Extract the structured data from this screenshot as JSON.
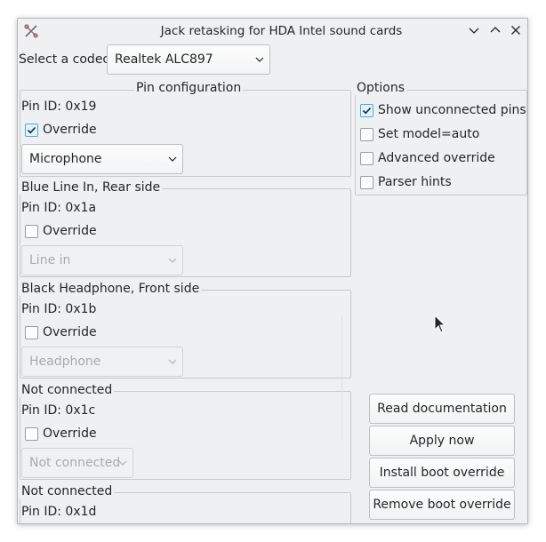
{
  "window": {
    "title": "Jack retasking for HDA Intel sound cards",
    "icons": [
      "app-icon",
      "minimize-icon",
      "maximize-icon",
      "close-icon"
    ]
  },
  "codec": {
    "label": "Select a codec:",
    "selected": "Realtek ALC897"
  },
  "pins": [
    {
      "title": "Pin configuration",
      "pin_id": "Pin ID: 0x19",
      "override_label": "Override",
      "override": true,
      "selection": "Microphone",
      "enabled": true
    },
    {
      "title": "Blue Line In, Rear side",
      "pin_id": "Pin ID: 0x1a",
      "override_label": "Override",
      "override": false,
      "selection": "Line in",
      "enabled": false
    },
    {
      "title": "Black Headphone, Front side",
      "pin_id": "Pin ID: 0x1b",
      "override_label": "Override",
      "override": false,
      "selection": "Headphone",
      "enabled": false
    },
    {
      "title": "Not connected",
      "pin_id": "Pin ID: 0x1c",
      "override_label": "Override",
      "override": false,
      "selection": "Not connected",
      "enabled": false
    },
    {
      "title": "Not connected",
      "pin_id": "Pin ID: 0x1d"
    }
  ],
  "options": {
    "title": "Options",
    "items": [
      {
        "label": "Show unconnected pins",
        "checked": true
      },
      {
        "label": "Set model=auto",
        "checked": false
      },
      {
        "label": "Advanced override",
        "checked": false
      },
      {
        "label": "Parser hints",
        "checked": false
      }
    ]
  },
  "buttons": {
    "read_doc": "Read documentation",
    "apply": "Apply now",
    "install": "Install boot override",
    "remove": "Remove boot override"
  },
  "colors": {
    "accent": "#3daee9",
    "window_bg": "#eff0f1"
  }
}
